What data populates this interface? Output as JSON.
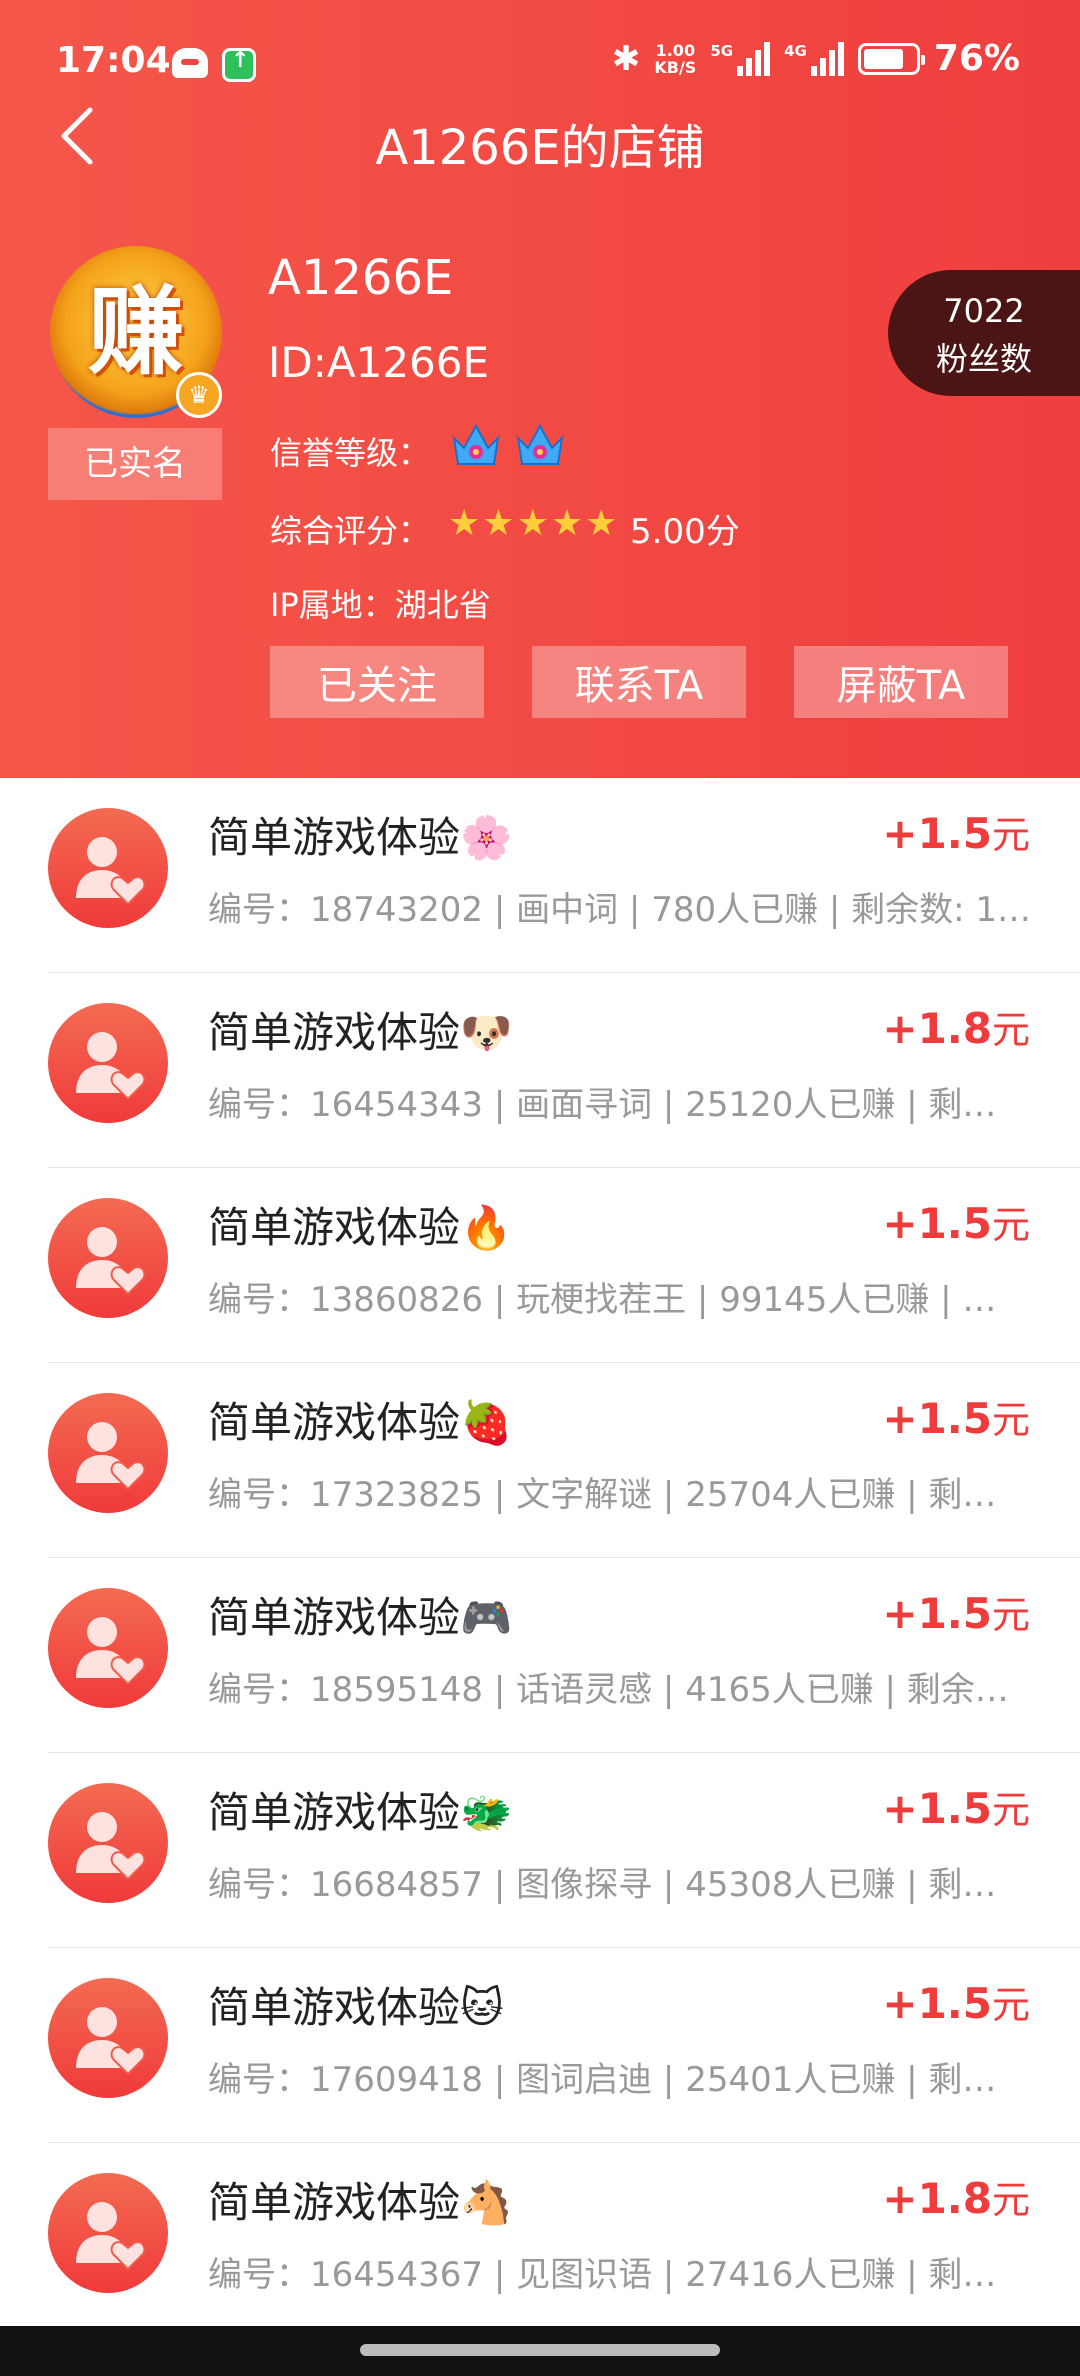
{
  "status_bar": {
    "time": "17:04",
    "network_speed_value": "1.00",
    "network_speed_unit": "KB/S",
    "net1": "5G",
    "net2": "4G",
    "battery": "76%",
    "bluetooth_icon": "bluetooth-icon"
  },
  "nav": {
    "title": "A1266E的店铺",
    "back_icon": "chevron-left-icon"
  },
  "profile": {
    "avatar_char": "赚",
    "verified_label": "已实名",
    "name": "A1266E",
    "id_text": "ID:A1266E",
    "reputation_label": "信誉等级：",
    "reputation_crowns": 2,
    "score_label": "综合评分：",
    "stars": 5,
    "score_value": "5.00分",
    "ip_text": "IP属地：湖北省",
    "fans_count": "7022",
    "fans_label": "粉丝数"
  },
  "actions": {
    "follow": "已关注",
    "contact": "联系TA",
    "block": "屏蔽TA"
  },
  "tasks": [
    {
      "title": "简单游戏体验🌸",
      "price": "+1.5",
      "unit": "元",
      "sub": "编号：18743202 | 画中词 | 780人已赚 | 剩余数: 1…"
    },
    {
      "title": "简单游戏体验🐶",
      "price": "+1.8",
      "unit": "元",
      "sub": "编号：16454343 | 画面寻词 | 25120人已赚 | 剩…"
    },
    {
      "title": "简单游戏体验🔥",
      "price": "+1.5",
      "unit": "元",
      "sub": "编号：13860826 | 玩梗找茬王 | 99145人已赚 | …"
    },
    {
      "title": "简单游戏体验🍓",
      "price": "+1.5",
      "unit": "元",
      "sub": "编号：17323825 | 文字解谜 | 25704人已赚 | 剩…"
    },
    {
      "title": "简单游戏体验🎮",
      "price": "+1.5",
      "unit": "元",
      "sub": "编号：18595148 | 话语灵感 | 4165人已赚 | 剩余…"
    },
    {
      "title": "简单游戏体验🐲",
      "price": "+1.5",
      "unit": "元",
      "sub": "编号：16684857 | 图像探寻 | 45308人已赚 | 剩…"
    },
    {
      "title": "简单游戏体验🐱",
      "price": "+1.5",
      "unit": "元",
      "sub": "编号：17609418 | 图词启迪 | 25401人已赚 | 剩…"
    },
    {
      "title": "简单游戏体验🐴",
      "price": "+1.8",
      "unit": "元",
      "sub": "编号：16454367 | 见图识语 | 27416人已赚 | 剩…"
    }
  ],
  "colors": {
    "header_red": "#ef4040",
    "price_red": "#ee3b3b",
    "fans_bg": "#4c1515"
  }
}
